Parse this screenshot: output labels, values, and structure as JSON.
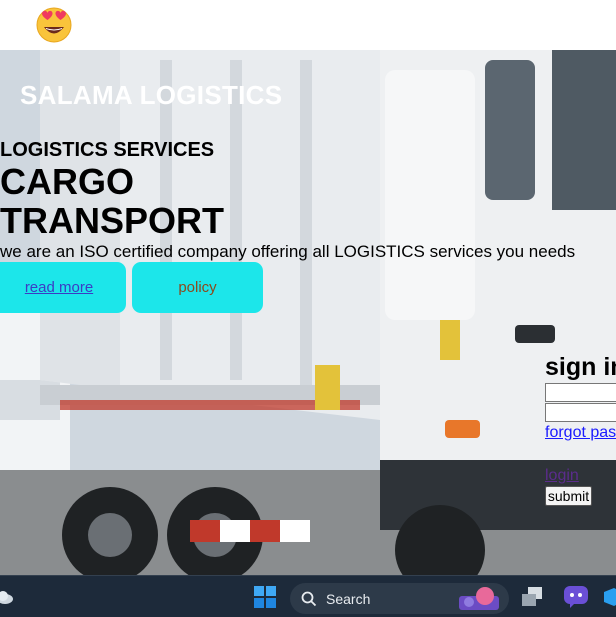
{
  "header": {
    "logo_icon": "heart-eyes-emoji-icon"
  },
  "hero": {
    "brand": "SALAMA LOGISTICS",
    "subtitle": "LOGISTICS SERVICES",
    "headline": "CARGO TRANSPORT",
    "tagline": "we are an ISO certified company offering all LOGISTICS services you needs",
    "buttons": {
      "read_more": "read more",
      "policy": "policy"
    },
    "button_color": "#1ce6ea"
  },
  "signin": {
    "title": "sign in",
    "forgot": "forgot password",
    "login": "login",
    "submit": "submit"
  },
  "taskbar": {
    "search_label": "Search",
    "icons": [
      "weather-icon",
      "windows-start-icon",
      "search-icon",
      "search-highlight-icon",
      "task-view-icon",
      "chat-icon",
      "vscode-icon"
    ],
    "background": "#1d2a3a"
  }
}
